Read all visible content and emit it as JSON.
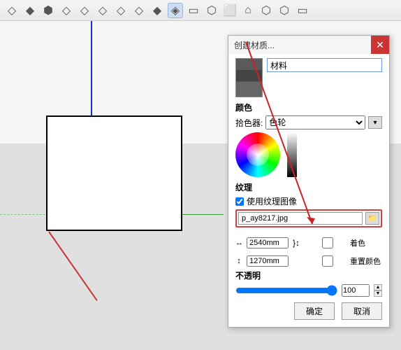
{
  "dialog": {
    "title": "创建材质...",
    "name_value": "材料",
    "color_section": "颜色",
    "picker_lbl": "拾色器:",
    "picker_value": "色轮",
    "texture_section": "纹理",
    "use_texture": "使用纹理图像",
    "file_value": "p_ay8217.jpg",
    "width_value": "2540mm",
    "height_value": "1270mm",
    "colorize": "着色",
    "reset_color": "重置颜色",
    "opacity_section": "不透明",
    "opacity_value": 100,
    "ok": "确定",
    "cancel": "取消"
  }
}
